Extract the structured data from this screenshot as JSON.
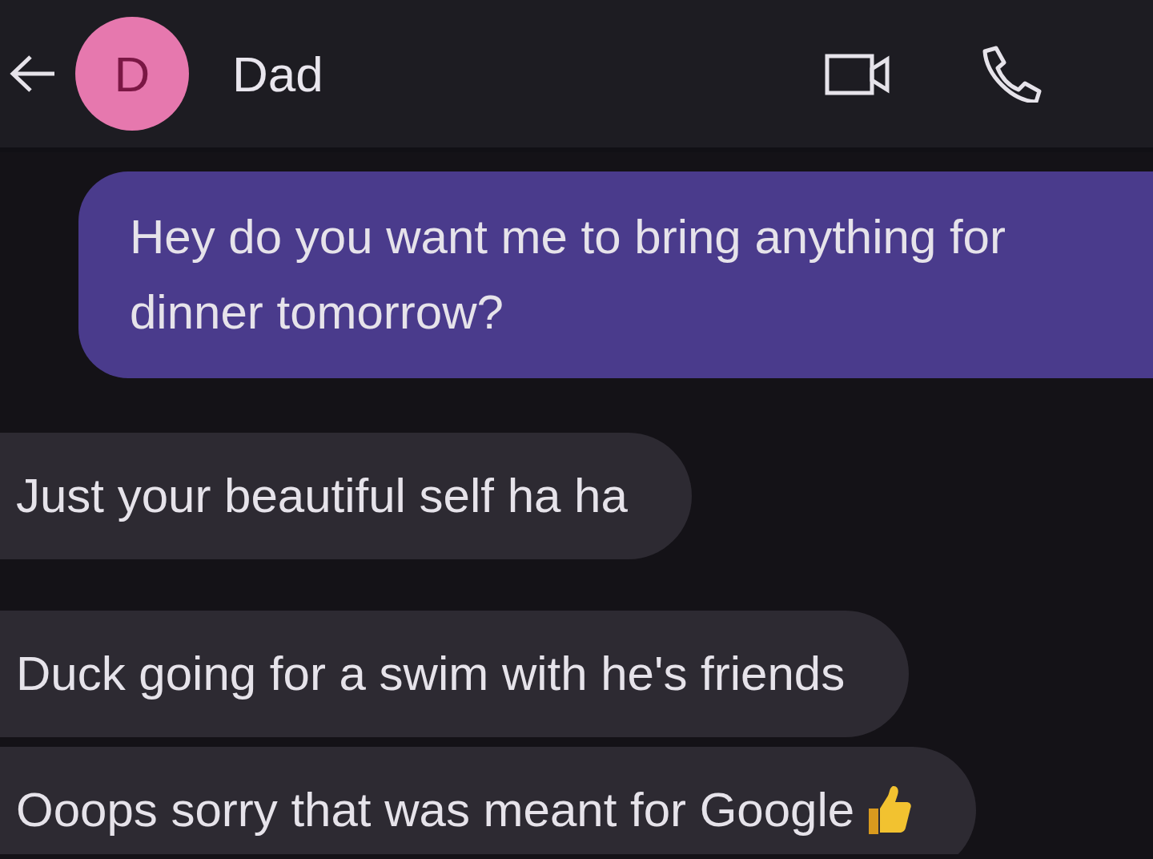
{
  "header": {
    "avatar_letter": "D",
    "contact_name": "Dad"
  },
  "messages": [
    {
      "kind": "sent",
      "text": "Hey do you want me to bring anything for dinner tomorrow?"
    },
    {
      "kind": "received",
      "text": "Just your beautiful self ha ha"
    },
    {
      "kind": "received",
      "text": "Duck going for a swim with he's friends"
    },
    {
      "kind": "received_thumbs_up",
      "text": "Ooops sorry that was meant for Google"
    }
  ]
}
